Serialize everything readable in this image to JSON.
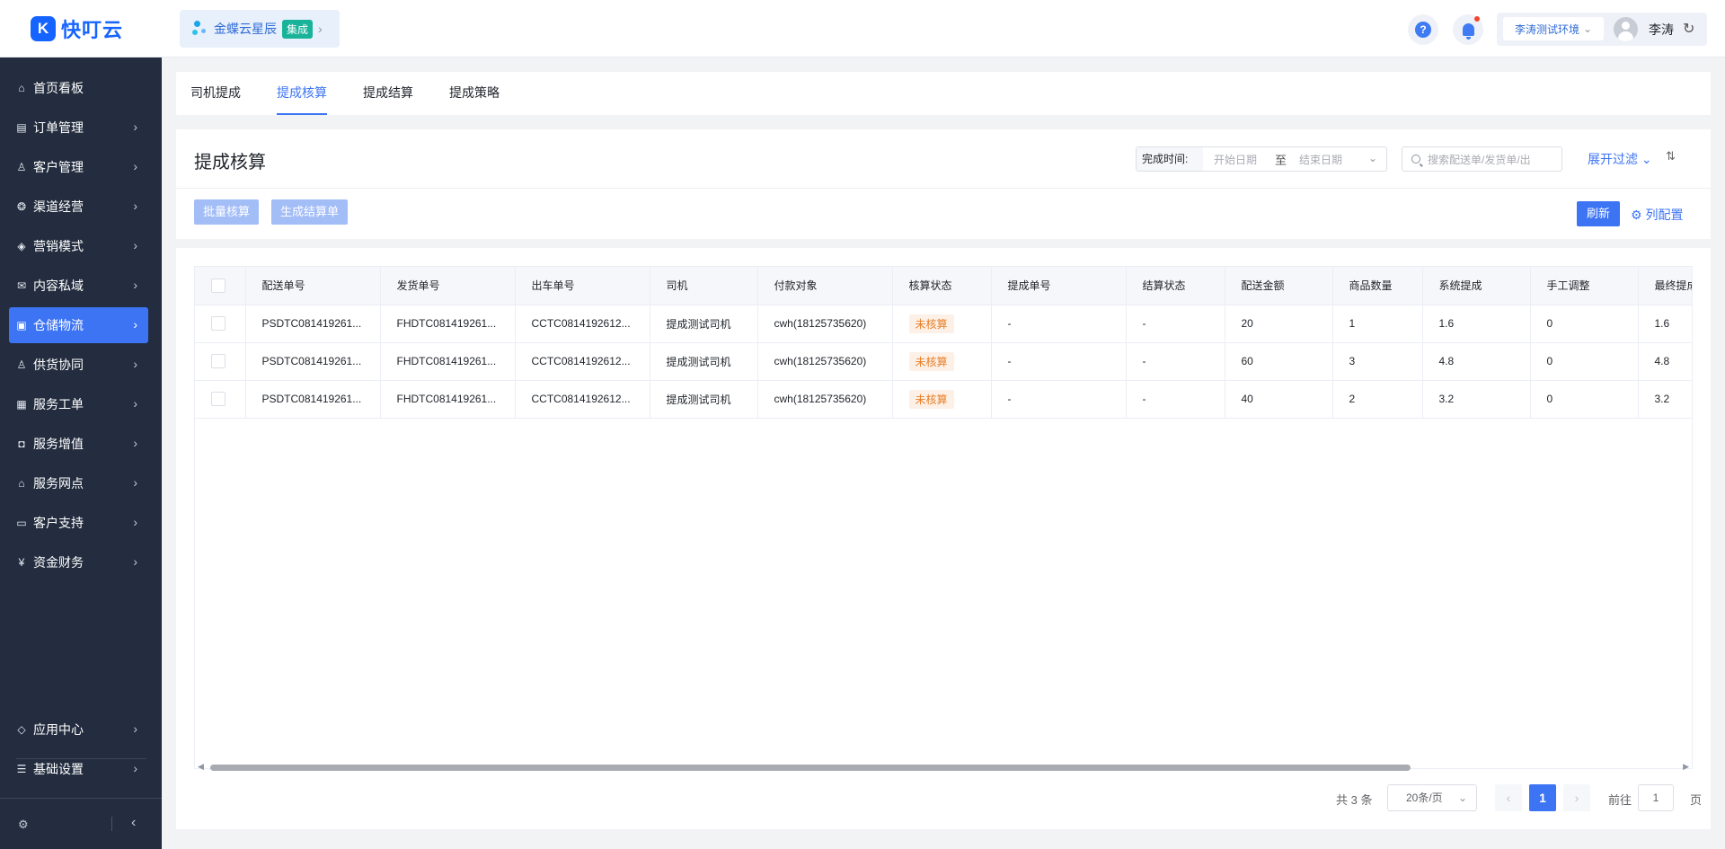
{
  "header": {
    "logo_mark": "K",
    "logo_text": "快叮云",
    "app_name": "金蝶云星辰",
    "app_tag": "集成",
    "help_glyph": "?",
    "env_label": "李涛测试环境",
    "user_name": "李涛"
  },
  "sidebar": {
    "items": [
      {
        "label": "首页看板",
        "icon": "home-icon",
        "glyph": "⌂"
      },
      {
        "label": "订单管理",
        "icon": "clipboard-icon",
        "glyph": "▤"
      },
      {
        "label": "客户管理",
        "icon": "user-icon",
        "glyph": "♙"
      },
      {
        "label": "渠道经营",
        "icon": "channel-icon",
        "glyph": "❂"
      },
      {
        "label": "营销模式",
        "icon": "tag-icon",
        "glyph": "◈"
      },
      {
        "label": "内容私域",
        "icon": "mail-icon",
        "glyph": "✉"
      },
      {
        "label": "仓储物流",
        "icon": "warehouse-icon",
        "glyph": "▣"
      },
      {
        "label": "供货协同",
        "icon": "supply-icon",
        "glyph": "♙"
      },
      {
        "label": "服务工单",
        "icon": "ticket-icon",
        "glyph": "▦"
      },
      {
        "label": "服务增值",
        "icon": "bag-icon",
        "glyph": "◘"
      },
      {
        "label": "服务网点",
        "icon": "store-icon",
        "glyph": "⌂"
      },
      {
        "label": "客户支持",
        "icon": "support-icon",
        "glyph": "▭"
      },
      {
        "label": "资金财务",
        "icon": "yuan-icon",
        "glyph": "¥"
      }
    ],
    "bottom_items": [
      {
        "label": "应用中心",
        "icon": "cube-icon",
        "glyph": "◇"
      },
      {
        "label": "基础设置",
        "icon": "settings-list-icon",
        "glyph": "☰"
      }
    ]
  },
  "tabs": [
    "司机提成",
    "提成核算",
    "提成结算",
    "提成策略"
  ],
  "filter": {
    "title": "提成核算",
    "date_label": "完成时间:",
    "start_placeholder": "开始日期",
    "date_separator": "至",
    "end_placeholder": "结束日期",
    "search_placeholder": "搜索配送单/发货单/出",
    "expand_label": "展开过滤",
    "batch_button": "批量核算",
    "generate_button": "生成结算单",
    "refresh_button": "刷新",
    "column_config": "列配置"
  },
  "table": {
    "columns": [
      "配送单号",
      "发货单号",
      "出车单号",
      "司机",
      "付款对象",
      "核算状态",
      "提成单号",
      "结算状态",
      "配送金额",
      "商品数量",
      "系统提成",
      "手工调整",
      "最终提成"
    ],
    "rows": [
      [
        "PSDTC081419261...",
        "FHDTC081419261...",
        "CCTC0814192612...",
        "提成测试司机",
        "cwh(18125735620)",
        "未核算",
        "-",
        "-",
        "20",
        "1",
        "1.6",
        "0",
        "1.6"
      ],
      [
        "PSDTC081419261...",
        "FHDTC081419261...",
        "CCTC0814192612...",
        "提成测试司机",
        "cwh(18125735620)",
        "未核算",
        "-",
        "-",
        "60",
        "3",
        "4.8",
        "0",
        "4.8"
      ],
      [
        "PSDTC081419261...",
        "FHDTC081419261...",
        "CCTC0814192612...",
        "提成测试司机",
        "cwh(18125735620)",
        "未核算",
        "-",
        "-",
        "40",
        "2",
        "3.2",
        "0",
        "3.2"
      ]
    ]
  },
  "pagination": {
    "total": "共 3 条",
    "page_size": "20条/页",
    "current_page": "1",
    "goto_label": "前往",
    "goto_value": "1",
    "page_suffix": "页"
  },
  "colors": {
    "primary": "#3d74f4",
    "sidebar_bg": "#232d3f",
    "status_badge": "#e8802a"
  }
}
